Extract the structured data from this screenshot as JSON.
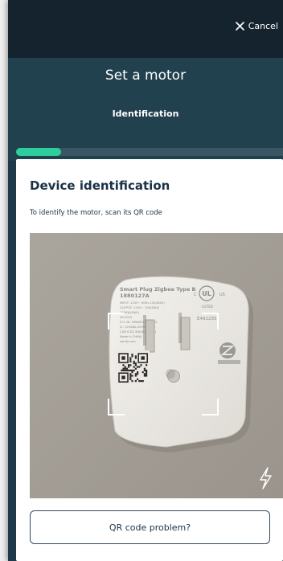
{
  "colors": {
    "accent": "#2ccf9b",
    "topbar": "#15232f",
    "header": "#22414f",
    "text_dark": "#1b3245"
  },
  "topbar": {
    "cancel_label": "Cancel",
    "cancel_icon": "close-icon"
  },
  "header": {
    "title": "Set a motor",
    "subtitle": "Identification"
  },
  "progress": {
    "fraction": 0.17
  },
  "card": {
    "title": "Device identification",
    "description": "To identify the motor, scan its QR code",
    "flash_icon": "flash-icon",
    "qr_problem_label": "QR code problem?"
  },
  "device_label": {
    "name": "Smart Plug Zigbee Type B",
    "model": "1880127A",
    "input": "INPUT: 120V~ 60Hz 15A(MAX)",
    "output": "OUTPUT: 120V~ 15A(MAX)",
    "max": "1800W(MAX)",
    "date": "06 2019",
    "fcc": "FCC ID: DWN8OMFYPLUG",
    "ic": "IC: 12048A-SOMFYPLUG",
    "can": "CAN ICES-3(B)/NMB-3(B)",
    "origin": "Made in CHINA",
    "site": "somfy.com",
    "ul_listed": "LISTED",
    "etl": "E491235"
  }
}
